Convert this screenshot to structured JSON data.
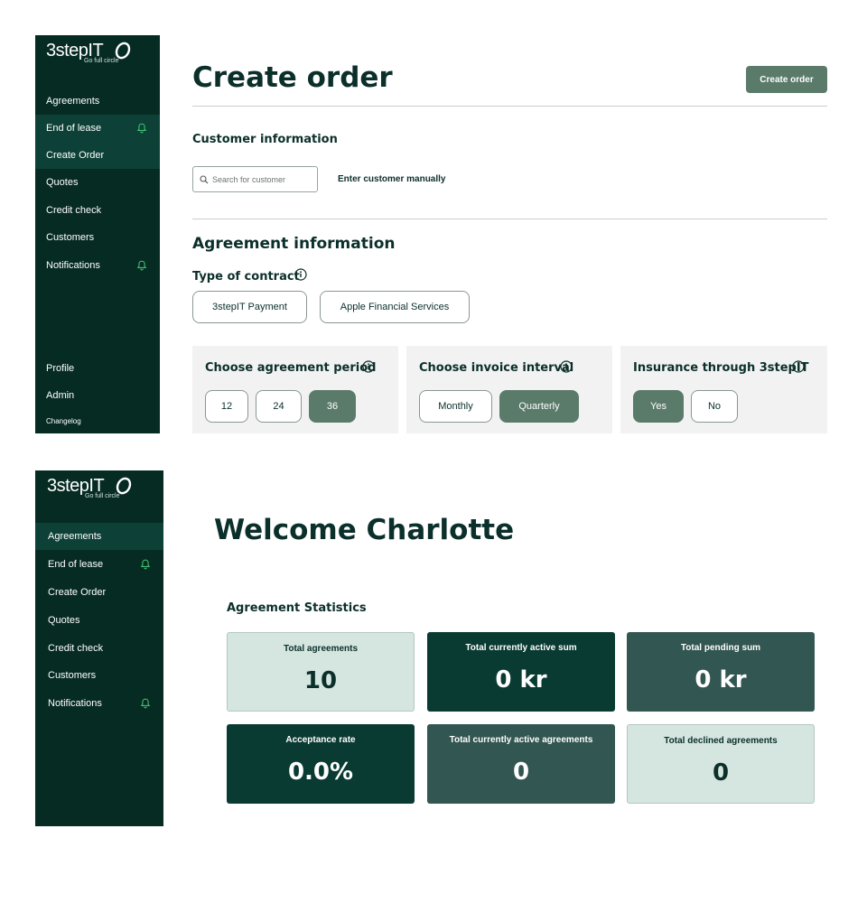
{
  "brand": {
    "name": "3stepIT",
    "tagline": "Go full circle"
  },
  "sidebar_top": {
    "items": [
      {
        "label": "Agreements",
        "active": false,
        "bell": false
      },
      {
        "label": "End of lease",
        "active": true,
        "bell": true
      },
      {
        "label": "Create Order",
        "active": true,
        "bell": false
      },
      {
        "label": "Quotes",
        "active": false,
        "bell": false
      },
      {
        "label": "Credit check",
        "active": false,
        "bell": false
      },
      {
        "label": "Customers",
        "active": false,
        "bell": false
      },
      {
        "label": "Notifications",
        "active": false,
        "bell": true
      }
    ],
    "bottom_items": [
      {
        "label": "Profile"
      },
      {
        "label": "Admin"
      },
      {
        "label": "Changelog"
      }
    ]
  },
  "create_order": {
    "title": "Create order",
    "button": "Create order",
    "customer_section": "Customer information",
    "search_placeholder": "Search for customer",
    "manual_link": "Enter customer manually",
    "agreement_section": "Agreement information",
    "contract_type_label": "Type of contract",
    "contract_options": [
      "3stepIT Payment",
      "Apple Financial Services"
    ],
    "period": {
      "title": "Choose agreement period",
      "options": [
        "12",
        "24",
        "36"
      ],
      "selected": "36"
    },
    "invoice": {
      "title": "Choose invoice interval",
      "options": [
        "Monthly",
        "Quarterly"
      ],
      "selected": "Quarterly"
    },
    "insurance": {
      "title": "Insurance through 3stepIT",
      "options": [
        "Yes",
        "No"
      ],
      "selected": "Yes"
    }
  },
  "sidebar_bottom": {
    "items": [
      {
        "label": "Agreements",
        "active": true,
        "bell": false
      },
      {
        "label": "End of lease",
        "active": false,
        "bell": true
      },
      {
        "label": "Create Order",
        "active": false,
        "bell": false
      },
      {
        "label": "Quotes",
        "active": false,
        "bell": false
      },
      {
        "label": "Credit check",
        "active": false,
        "bell": false
      },
      {
        "label": "Customers",
        "active": false,
        "bell": false
      },
      {
        "label": "Notifications",
        "active": false,
        "bell": true
      }
    ]
  },
  "dashboard": {
    "title": "Welcome Charlotte",
    "stats_title": "Agreement Statistics",
    "stats": [
      {
        "label": "Total agreements",
        "value": "10",
        "style": "light"
      },
      {
        "label": "Total currently active sum",
        "value": "0 kr",
        "style": "dark"
      },
      {
        "label": "Total pending sum",
        "value": "0 kr",
        "style": "mid"
      },
      {
        "label": "Acceptance rate",
        "value": "0.0%",
        "style": "dark"
      },
      {
        "label": "Total currently active agreements",
        "value": "0",
        "style": "mid"
      },
      {
        "label": "Total declined agreements",
        "value": "0",
        "style": "light"
      }
    ]
  },
  "colors": {
    "sidebar_bg": "#062b23",
    "sidebar_active": "#0d4137",
    "accent_button": "#5a7a6a",
    "bell_green": "#3fbf6f",
    "text_dark": "#0b2f2a"
  }
}
